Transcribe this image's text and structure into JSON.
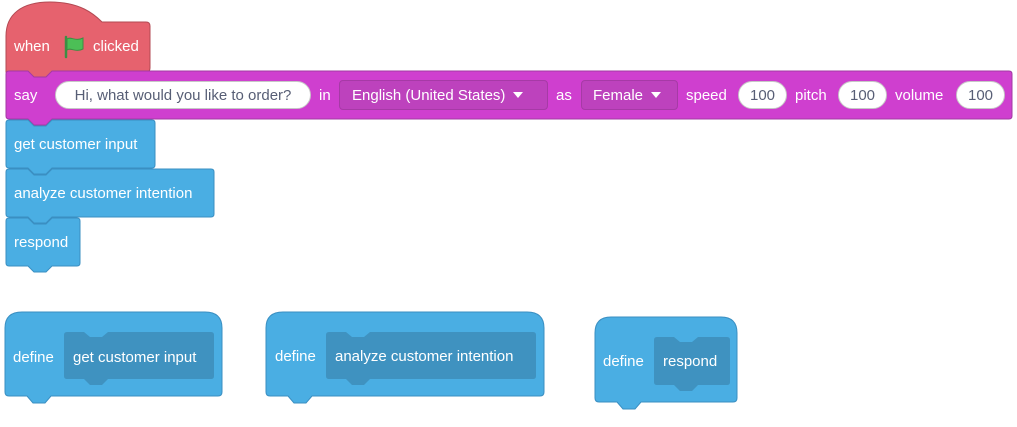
{
  "colors": {
    "event": "#e6626e",
    "event_border": "#b34a53",
    "sound": "#cf3fcf",
    "sound_border": "#a33aa3",
    "custom": "#4aaee3",
    "custom_border": "#3a8fc2",
    "custom_inner": "#3f92c0",
    "flag": "#4cbf56"
  },
  "script": {
    "hat": {
      "when": "when",
      "flag_icon": "green-flag-icon",
      "clicked": "clicked"
    },
    "say": {
      "label": "say",
      "message": "Hi, what would you like to order?",
      "in_label": "in",
      "language": "English (United States)",
      "as_label": "as",
      "voice": "Female",
      "speed_label": "speed",
      "speed": "100",
      "pitch_label": "pitch",
      "pitch": "100",
      "volume_label": "volume",
      "volume": "100"
    },
    "calls": [
      "get customer input",
      "analyze customer intention",
      "respond"
    ]
  },
  "definitions": [
    {
      "label": "define",
      "name": "get customer input"
    },
    {
      "label": "define",
      "name": "analyze customer intention"
    },
    {
      "label": "define",
      "name": "respond"
    }
  ]
}
